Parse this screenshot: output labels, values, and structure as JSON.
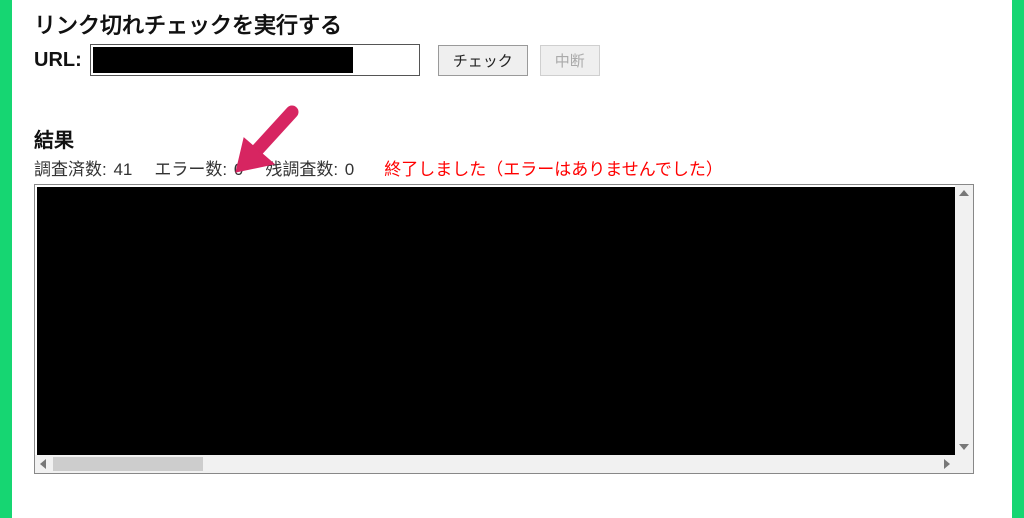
{
  "header": {
    "title": "リンク切れチェックを実行する",
    "url_label": "URL:",
    "url_value": ""
  },
  "buttons": {
    "check_label": "チェック",
    "abort_label": "中断"
  },
  "result": {
    "heading": "結果",
    "stats": {
      "checked_label": "調査済数:",
      "checked_value": "41",
      "error_label": "エラー数:",
      "error_value": "0",
      "remaining_label": "残調査数:",
      "remaining_value": "0"
    },
    "status_message": "終了しました（エラーはありませんでした）"
  },
  "colors": {
    "accent_border": "#16d672",
    "status_text": "#ff0000",
    "annotation_arrow": "#d72561"
  }
}
